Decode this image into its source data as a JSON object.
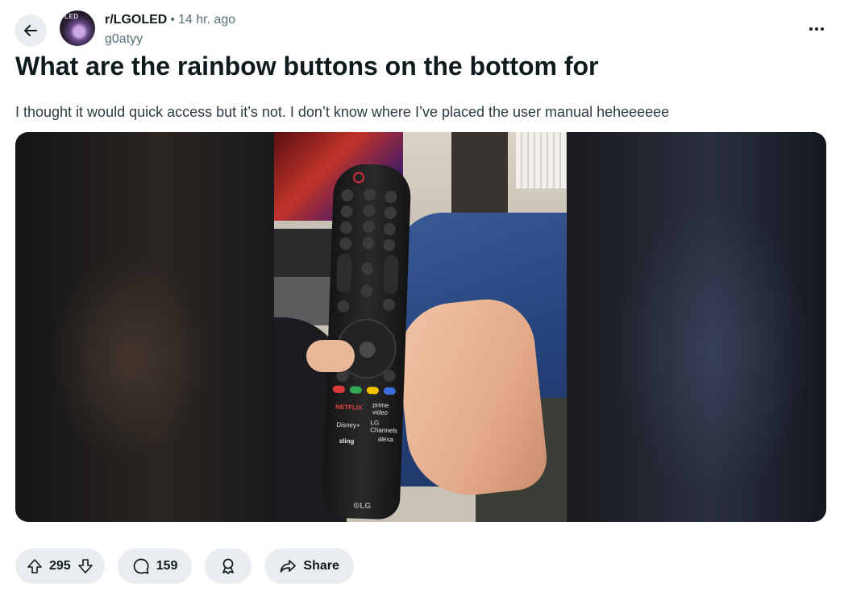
{
  "post": {
    "subreddit": "r/LGOLED",
    "separator": "•",
    "age": "14 hr. ago",
    "author": "g0atyy",
    "title": "What are the rainbow buttons on the bottom for",
    "body": "I thought it would quick access but it’s not. I don’t know where I’ve placed the user manual heheeeeee"
  },
  "actions": {
    "upvotes": "295",
    "comments": "159",
    "share_label": "Share"
  },
  "icons": {
    "back": "arrow-left-icon",
    "more": "ellipsis-icon",
    "upvote": "upvote-icon",
    "downvote": "downvote-icon",
    "comment": "comment-icon",
    "award": "award-icon",
    "share": "share-icon"
  },
  "colors": {
    "pill_bg": "#eaedef",
    "text": "#0f1a1c",
    "muted": "#576f76"
  }
}
